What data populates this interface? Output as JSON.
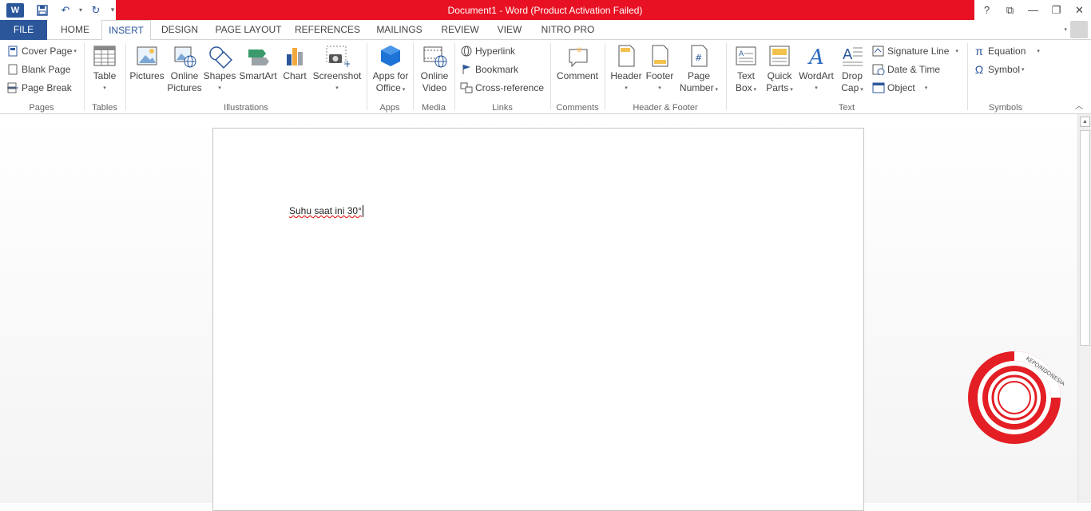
{
  "window": {
    "title": "Document1 -  Word (Product Activation Failed)",
    "accent_color": "#2b579a",
    "title_bar_color": "#e81123",
    "controls": {
      "help": "?",
      "restore_ribbon": "⧉",
      "minimize": "—",
      "maximize": "❐",
      "close": "✕"
    }
  },
  "quick_access": {
    "app_icon": "W",
    "save": "💾",
    "undo": "↶",
    "redo": "↻",
    "customize": "▾"
  },
  "tabs": [
    {
      "label": "FILE"
    },
    {
      "label": "HOME"
    },
    {
      "label": "INSERT"
    },
    {
      "label": "DESIGN"
    },
    {
      "label": "PAGE LAYOUT"
    },
    {
      "label": "REFERENCES"
    },
    {
      "label": "MAILINGS"
    },
    {
      "label": "REVIEW"
    },
    {
      "label": "VIEW"
    },
    {
      "label": "NITRO PRO"
    }
  ],
  "active_tab": "INSERT",
  "ribbon": {
    "pages": {
      "label": "Pages",
      "cover_page": "Cover Page",
      "blank_page": "Blank Page",
      "page_break": "Page Break"
    },
    "tables": {
      "label": "Tables",
      "table": "Table"
    },
    "illustrations": {
      "label": "Illustrations",
      "pictures": "Pictures",
      "online_pictures_1": "Online",
      "online_pictures_2": "Pictures",
      "shapes": "Shapes",
      "smartart": "SmartArt",
      "chart": "Chart",
      "screenshot": "Screenshot"
    },
    "apps": {
      "label": "Apps",
      "apps_for_office_1": "Apps for",
      "apps_for_office_2": "Office"
    },
    "media": {
      "label": "Media",
      "online_video_1": "Online",
      "online_video_2": "Video"
    },
    "links": {
      "label": "Links",
      "hyperlink": "Hyperlink",
      "bookmark": "Bookmark",
      "cross_reference": "Cross-reference"
    },
    "comments": {
      "label": "Comments",
      "comment": "Comment"
    },
    "header_footer": {
      "label": "Header & Footer",
      "header": "Header",
      "footer": "Footer",
      "page_number_1": "Page",
      "page_number_2": "Number"
    },
    "text": {
      "label": "Text",
      "text_box_1": "Text",
      "text_box_2": "Box",
      "quick_parts_1": "Quick",
      "quick_parts_2": "Parts",
      "wordart": "WordArt",
      "drop_cap_1": "Drop",
      "drop_cap_2": "Cap",
      "signature_line": "Signature Line",
      "date_time": "Date & Time",
      "object": "Object"
    },
    "symbols": {
      "label": "Symbols",
      "equation": "Equation",
      "symbol": "Symbol"
    }
  },
  "document": {
    "text": "Suhu saat ini 30°"
  },
  "watermark": {
    "text": "KEPOINDONESIA",
    "color": "#e31e24"
  }
}
